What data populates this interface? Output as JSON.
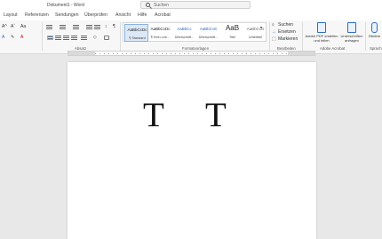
{
  "titlebar": {
    "doc_title": "Dokument1 - Word",
    "search_placeholder": "Suchen"
  },
  "tabs": [
    "Layout",
    "Referenzen",
    "Sendungen",
    "Überprüfen",
    "Ansicht",
    "Hilfe",
    "Acrobat"
  ],
  "ribbon": {
    "groups": {
      "paragraph": "Absatz",
      "styles": "Formatvorlagen",
      "editing": "Bearbeiten",
      "acrobat": "Adobe Acrobat"
    },
    "styles": [
      {
        "sample": "AaBbCcDc",
        "name": "¶ Standard"
      },
      {
        "sample": "AaBbCcDc",
        "name": "¶ Kein Lee..."
      },
      {
        "sample": "AaBbCc",
        "name": "Überschrift..."
      },
      {
        "sample": "AaBbCcE",
        "name": "Überschrift..."
      },
      {
        "sample": "AaB",
        "name": "Titel"
      },
      {
        "sample": "AaBbCcD",
        "name": "Untertitel"
      }
    ],
    "editing": {
      "find": "Suchen",
      "replace": "Ersetzen",
      "select": "Markieren"
    },
    "acrobat": {
      "create_pdf": "Adobe PDF erstellen und teilen",
      "sign": "Unterschriften anfragen"
    },
    "dictate": "Diktiere",
    "speak": "Sprach"
  },
  "document": {
    "text": [
      "T",
      "T"
    ]
  }
}
